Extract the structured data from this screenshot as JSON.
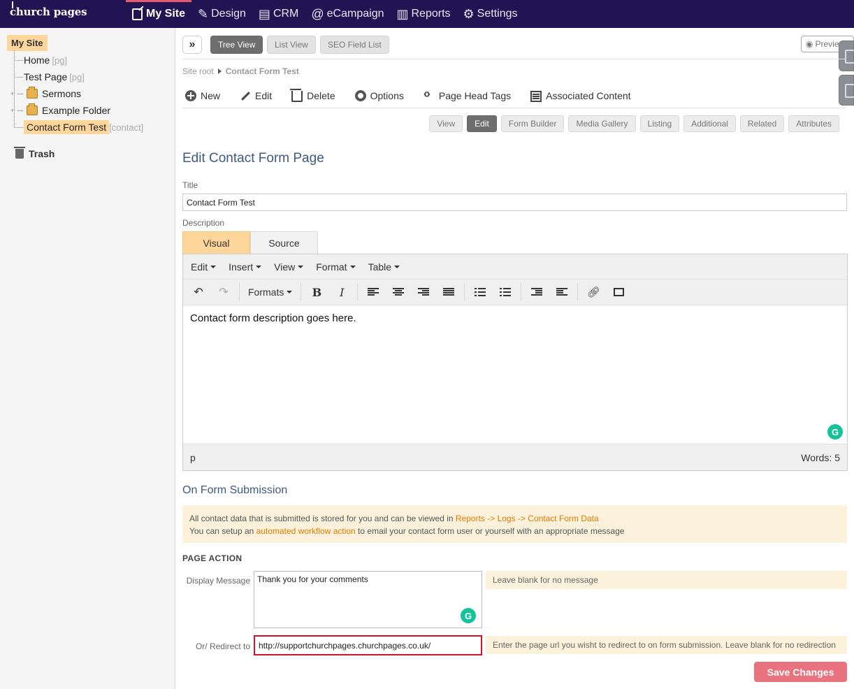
{
  "app": {
    "logo": "church pages"
  },
  "topnav": {
    "items": [
      {
        "label": "My Site",
        "icon": "page-edit-icon"
      },
      {
        "label": "Design",
        "icon": "brush-icon"
      },
      {
        "label": "CRM",
        "icon": "contacts-icon"
      },
      {
        "label": "eCampaign",
        "icon": "at-icon"
      },
      {
        "label": "Reports",
        "icon": "chart-icon"
      },
      {
        "label": "Settings",
        "icon": "gear-icon"
      }
    ],
    "active": "My Site",
    "active_color": "#e35a6f",
    "bg_color": "#211452"
  },
  "sidebar": {
    "root": "My Site",
    "nodes": [
      {
        "label": "Home",
        "tag": "[pg]"
      },
      {
        "label": "Test Page",
        "tag": "[pg]"
      },
      {
        "label": "Sermons",
        "tag": ""
      },
      {
        "label": "Example Folder",
        "tag": ""
      },
      {
        "label": "Contact Form Test",
        "tag": "[contact]"
      }
    ],
    "trash": "Trash"
  },
  "view_toggle": {
    "tree": "Tree View",
    "list": "List View",
    "seo": "SEO Field List",
    "preview": "Preview"
  },
  "breadcrumb": {
    "root": "Site root",
    "current": "Contact Form Test"
  },
  "actions": {
    "new": "New",
    "edit": "Edit",
    "delete": "Delete",
    "options": "Options",
    "head_tags": "Page Head Tags",
    "associated": "Associated Content"
  },
  "page_tabs": {
    "view": "View",
    "edit": "Edit",
    "form_builder": "Form Builder",
    "media_gallery": "Media Gallery",
    "listing": "Listing",
    "additional": "Additional",
    "related": "Related",
    "attributes": "Attributes"
  },
  "form": {
    "heading": "Edit Contact Form Page",
    "title_label": "Title",
    "title_value": "Contact Form Test",
    "description_label": "Description"
  },
  "editor": {
    "tab_visual": "Visual",
    "tab_source": "Source",
    "menus": {
      "edit": "Edit",
      "insert": "Insert",
      "view": "View",
      "format": "Format",
      "table": "Table"
    },
    "formats": "Formats",
    "content": "Contact form description goes here.",
    "path": "p",
    "words": "Words: 5"
  },
  "submission": {
    "heading": "On Form Submission",
    "info_line1_prefix": "All contact data that is submitted is stored for you and can be viewed in ",
    "info_line1_link": "Reports -> Logs -> Contact Form Data",
    "info_line2_prefix": "You can setup an ",
    "info_line2_link": "automated workflow action",
    "info_line2_suffix": " to email your contact form user or yourself with an appropriate message",
    "page_action": "PAGE ACTION",
    "display_message_label": "Display Message",
    "display_message_value": "Thank you for your comments",
    "display_message_hint": "Leave blank for no message",
    "redirect_label": "Or/ Redirect to",
    "redirect_value": "http://supportchurchpages.churchpages.co.uk/",
    "redirect_hint": "Enter the page url you wisht to redirect to on form submission. Leave blank for no redirection",
    "save": "Save Changes"
  }
}
